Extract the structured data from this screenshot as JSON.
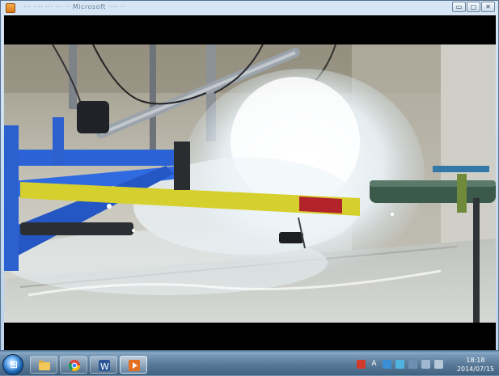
{
  "window": {
    "title": "··· ···· ··· ··· ·· Microsoft ···· ··",
    "buttons": [
      "▭",
      "▢",
      "✕"
    ]
  },
  "video": {
    "description_icon": "video-frame"
  },
  "taskbar": {
    "items": [
      {
        "name": "file-explorer",
        "icon": "folder-icon"
      },
      {
        "name": "chrome",
        "icon": "chrome-icon"
      },
      {
        "name": "word",
        "icon": "word-icon",
        "label": "W"
      },
      {
        "name": "media-player",
        "icon": "media-player-icon"
      }
    ],
    "tray": {
      "lang": "A",
      "time": "18:18",
      "date": "2014/07/15"
    }
  },
  "colors": {
    "frame_blue": "#2b63d6",
    "yellow_bar": "#d6d02f",
    "red_band": "#b2232a",
    "green_pipe": "#3c5a4b",
    "spray": "#e8f2f8"
  }
}
